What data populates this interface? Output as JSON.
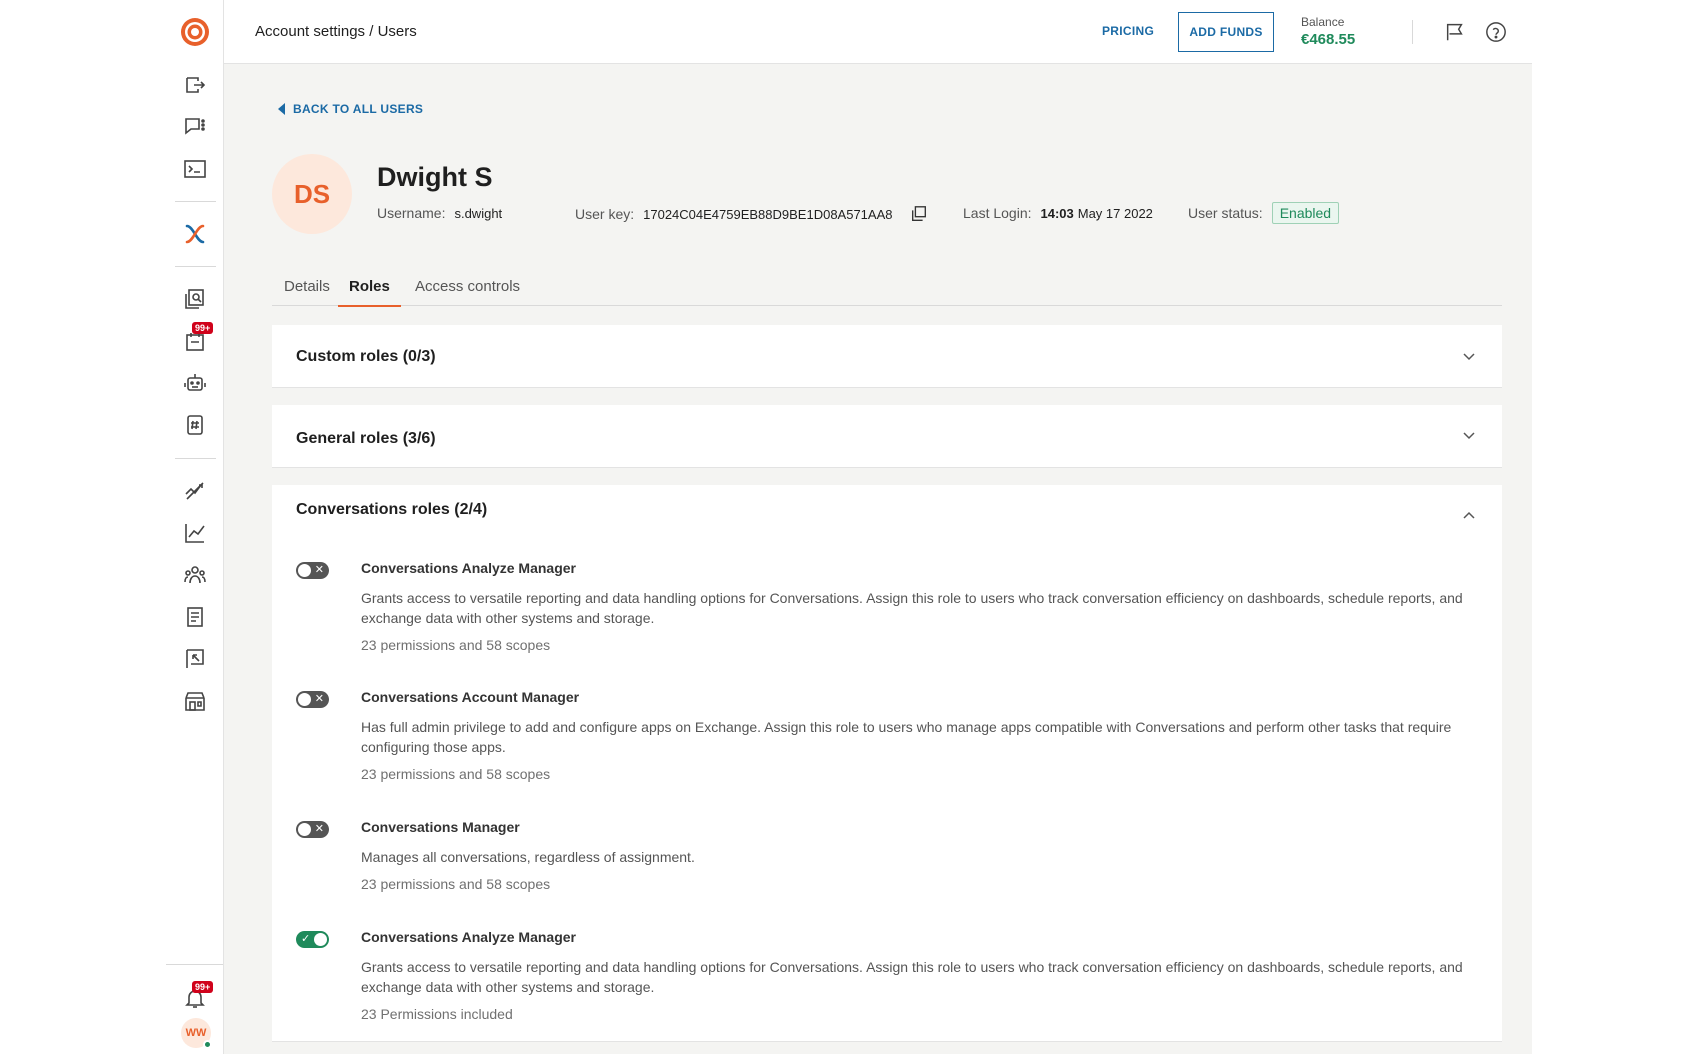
{
  "header": {
    "breadcrumb": "Account settings / Users",
    "pricing_label": "PRICING",
    "add_funds_label": "ADD FUNDS",
    "balance_label": "Balance",
    "balance_value": "€468.55"
  },
  "sidebar": {
    "tasks_badge": "99+",
    "notifications_badge": "99+",
    "user_initials": "WW"
  },
  "page": {
    "back_label": "BACK TO ALL USERS"
  },
  "user": {
    "initials": "DS",
    "name": "Dwight S",
    "username_label": "Username:",
    "username": "s.dwight",
    "user_key_label": "User key:",
    "user_key": "17024C04E4759EB88D9BE1D08A571AA8",
    "last_login_label": "Last Login:",
    "last_login_time": "14:03",
    "last_login_date": "May 17 2022",
    "status_label": "User status:",
    "status": "Enabled"
  },
  "tabs": [
    {
      "label": "Details"
    },
    {
      "label": "Roles"
    },
    {
      "label": "Access controls"
    }
  ],
  "panels": {
    "custom_roles": "Custom roles (0/3)",
    "general_roles": "General roles (3/6)",
    "conversations_roles": "Conversations roles (2/4)"
  },
  "roles": [
    {
      "name": "Conversations Analyze Manager",
      "description": "Grants access to versatile reporting and data handling options for Conversations. Assign this role to users who track conversation efficiency on dashboards, schedule reports, and exchange data with other systems and storage.",
      "count": "23 permissions and 58 scopes",
      "enabled": false
    },
    {
      "name": "Conversations Account Manager",
      "description": "Has full admin privilege to add and configure apps on Exchange. Assign this role to users who manage apps compatible with Conversations and perform other tasks that require configuring those apps.",
      "count": "23 permissions and 58 scopes",
      "enabled": false
    },
    {
      "name": "Conversations Manager",
      "description": "Manages all conversations, regardless of assignment.",
      "count": "23 permissions and 58 scopes",
      "enabled": false
    },
    {
      "name": "Conversations Analyze Manager",
      "description": "Grants access to versatile reporting and data handling options for Conversations. Assign this role to users who track conversation efficiency on dashboards, schedule reports, and exchange data with other systems and storage.",
      "count": "23 Permissions included",
      "enabled": true
    }
  ],
  "colors": {
    "accent": "#e8602b",
    "link": "#1b6aa5",
    "success": "#1f8a5b",
    "badge": "#d0021b"
  }
}
